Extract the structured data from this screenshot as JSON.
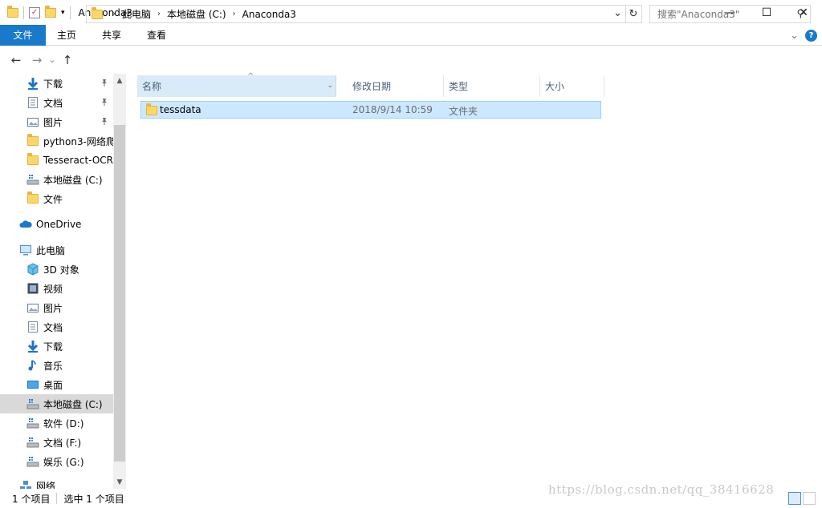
{
  "window": {
    "title": "Anaconda3"
  },
  "window_controls": {
    "minimize": "—",
    "maximize": "☐",
    "close": "✕"
  },
  "ribbon": {
    "tabs": [
      "文件",
      "主页",
      "共享",
      "查看"
    ],
    "collapse_glyph": "⌄",
    "help_glyph": "?"
  },
  "nav": {
    "back_glyph": "←",
    "forward_glyph": "→",
    "recent_glyph": "⌄",
    "up_glyph": "↑",
    "refresh_glyph": "↻",
    "address_dropdown_glyph": "⌄"
  },
  "address": {
    "separator": "›",
    "crumbs": [
      "此电脑",
      "本地磁盘 (C:)",
      "Anaconda3"
    ]
  },
  "search": {
    "placeholder": "搜索\"Anaconda3\"",
    "icon_glyph": "⚲"
  },
  "sidebar": {
    "items": [
      {
        "label": "下载",
        "icon": "download-icon",
        "pinned": true
      },
      {
        "label": "文档",
        "icon": "document-icon",
        "pinned": true
      },
      {
        "label": "图片",
        "icon": "picture-icon",
        "pinned": true
      },
      {
        "label": "python3-网络爬",
        "icon": "folder-icon",
        "pinned": false
      },
      {
        "label": "Tesseract-OCR",
        "icon": "folder-icon",
        "pinned": false
      },
      {
        "label": "本地磁盘 (C:)",
        "icon": "drive-icon",
        "pinned": false
      },
      {
        "label": "文件",
        "icon": "folder-icon",
        "pinned": false
      },
      {
        "label": "OneDrive",
        "icon": "cloud-icon",
        "pinned": false
      },
      {
        "label": "此电脑",
        "icon": "computer-icon",
        "pinned": false
      },
      {
        "label": "3D 对象",
        "icon": "cube-icon",
        "pinned": false
      },
      {
        "label": "视频",
        "icon": "video-icon",
        "pinned": false
      },
      {
        "label": "图片",
        "icon": "picture-icon",
        "pinned": false
      },
      {
        "label": "文档",
        "icon": "document-icon",
        "pinned": false
      },
      {
        "label": "下载",
        "icon": "download-icon",
        "pinned": false
      },
      {
        "label": "音乐",
        "icon": "music-icon",
        "pinned": false
      },
      {
        "label": "桌面",
        "icon": "desktop-icon",
        "pinned": false
      },
      {
        "label": "本地磁盘 (C:)",
        "icon": "drive-icon",
        "pinned": false,
        "selected": true
      },
      {
        "label": "软件 (D:)",
        "icon": "drive-icon",
        "pinned": false
      },
      {
        "label": "文档 (F:)",
        "icon": "drive-icon",
        "pinned": false
      },
      {
        "label": "娱乐 (G:)",
        "icon": "drive-icon",
        "pinned": false
      },
      {
        "label": "网络",
        "icon": "network-icon",
        "pinned": false
      }
    ],
    "pin_glyph": "📌",
    "scroll_up_glyph": "▲",
    "scroll_down_glyph": "▼"
  },
  "columns": [
    "名称",
    "修改日期",
    "类型",
    "大小"
  ],
  "sort_glyph": "^",
  "header_dropdown_glyph": "⌄",
  "files": [
    {
      "name": "tessdata",
      "modified": "2018/9/14 10:59",
      "type": "文件夹",
      "size": ""
    }
  ],
  "status": {
    "item_count": "1 个项目",
    "selected_count": "选中 1 个项目"
  },
  "watermark": "https://blog.csdn.net/qq_38416628",
  "colors": {
    "accent": "#1979ca",
    "selection": "#cce8ff",
    "selection_border": "#99d1ff"
  }
}
